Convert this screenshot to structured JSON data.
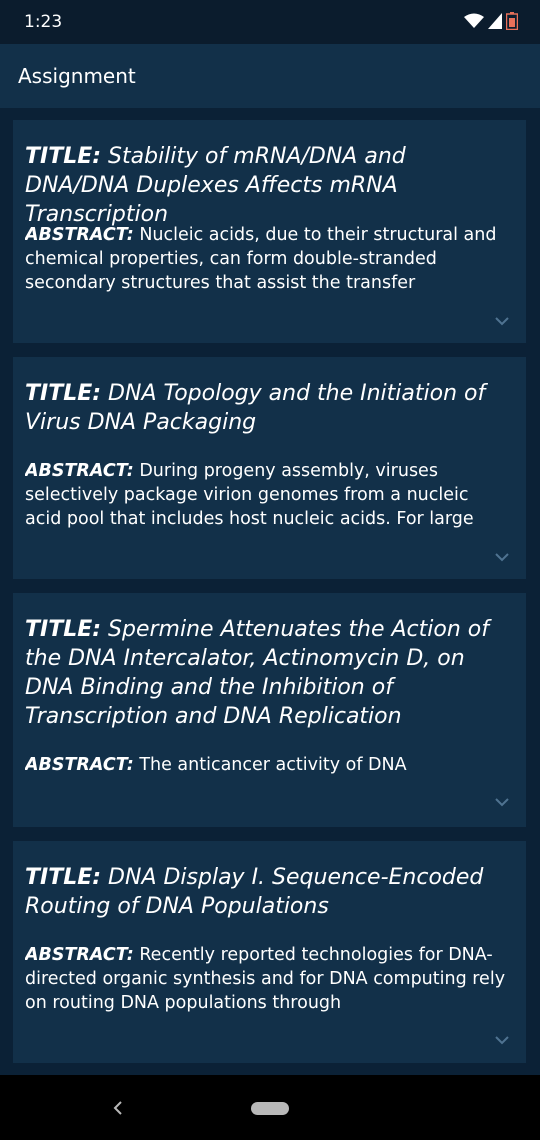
{
  "status_bar": {
    "time": "1:23",
    "icons": [
      "wifi-icon",
      "signal-icon",
      "battery-icon"
    ]
  },
  "app_bar": {
    "title": "Assignment"
  },
  "labels": {
    "title": "TITLE:",
    "abstract": "ABSTRACT:"
  },
  "cards": [
    {
      "title": "Stability of mRNA/DNA and DNA/DNA Duplexes Affects mRNA Transcription",
      "abstract": "Nucleic acids, due to their structural and chemical properties, can form double-stranded secondary structures that assist the transfer"
    },
    {
      "title": "DNA Topology and the Initiation of Virus DNA Packaging",
      "abstract": "During progeny assembly, viruses selectively package virion genomes from a nucleic acid pool that includes host nucleic acids. For large"
    },
    {
      "title": "Spermine Attenuates the Action of the DNA Intercalator, Actinomycin D, on DNA Binding and the Inhibition of Transcription and DNA Replication",
      "abstract": "The anticancer activity of DNA"
    },
    {
      "title": "DNA Display I. Sequence-Encoded Routing of DNA Populations",
      "abstract": "Recently reported technologies for DNA-directed organic synthesis and for DNA computing rely on routing DNA populations through"
    }
  ],
  "nav_bar": {
    "icons": [
      "back-icon",
      "home-pill"
    ]
  },
  "colors": {
    "background": "#0b2136",
    "card": "#123049",
    "status_bar": "#0b1c2d",
    "chevron": "#4f7391"
  }
}
